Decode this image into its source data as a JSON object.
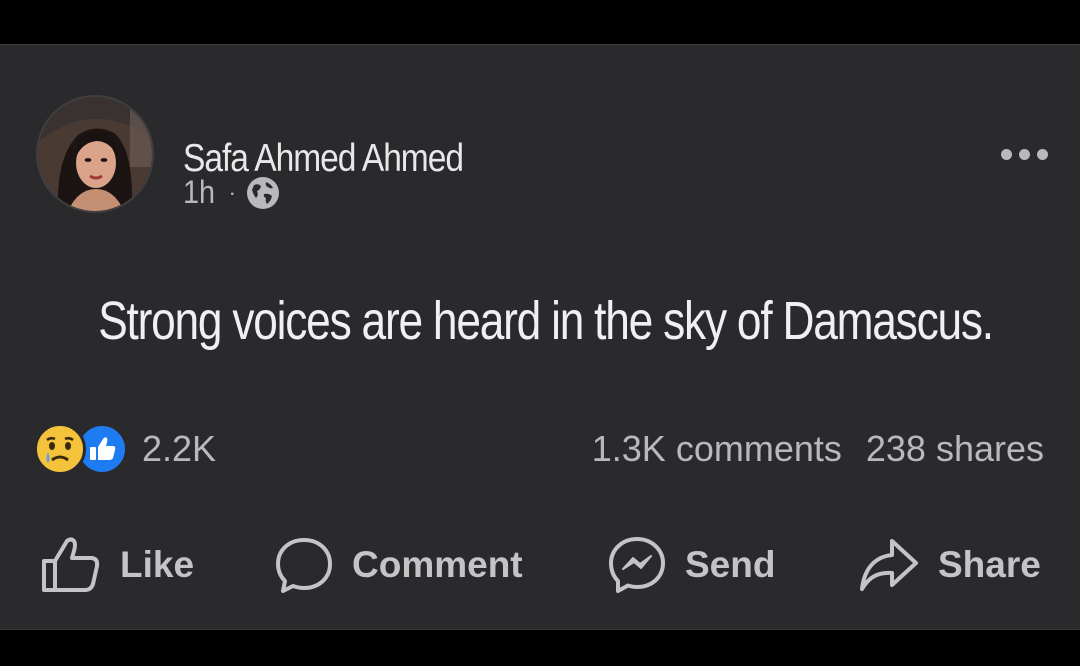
{
  "post": {
    "author": "Safa Ahmed Ahmed",
    "time": "1h",
    "separator": "·",
    "visibility_icon": "globe-icon",
    "text": "Strong voices are heard in the sky of Damascus.",
    "reactions": {
      "icons": [
        "sad-reaction-icon",
        "like-reaction-icon"
      ],
      "count": "2.2K"
    },
    "comments": "1.3K comments",
    "shares": "238 shares"
  },
  "actions": {
    "like": "Like",
    "comment": "Comment",
    "send": "Send",
    "share": "Share"
  },
  "colors": {
    "background": "#000000",
    "card": "#2a2a2c",
    "text_primary": "#f0f0f2",
    "text_secondary": "#b9b9bc",
    "like_blue": "#1f7bf2",
    "sad_yellow": "#f5c33b"
  }
}
